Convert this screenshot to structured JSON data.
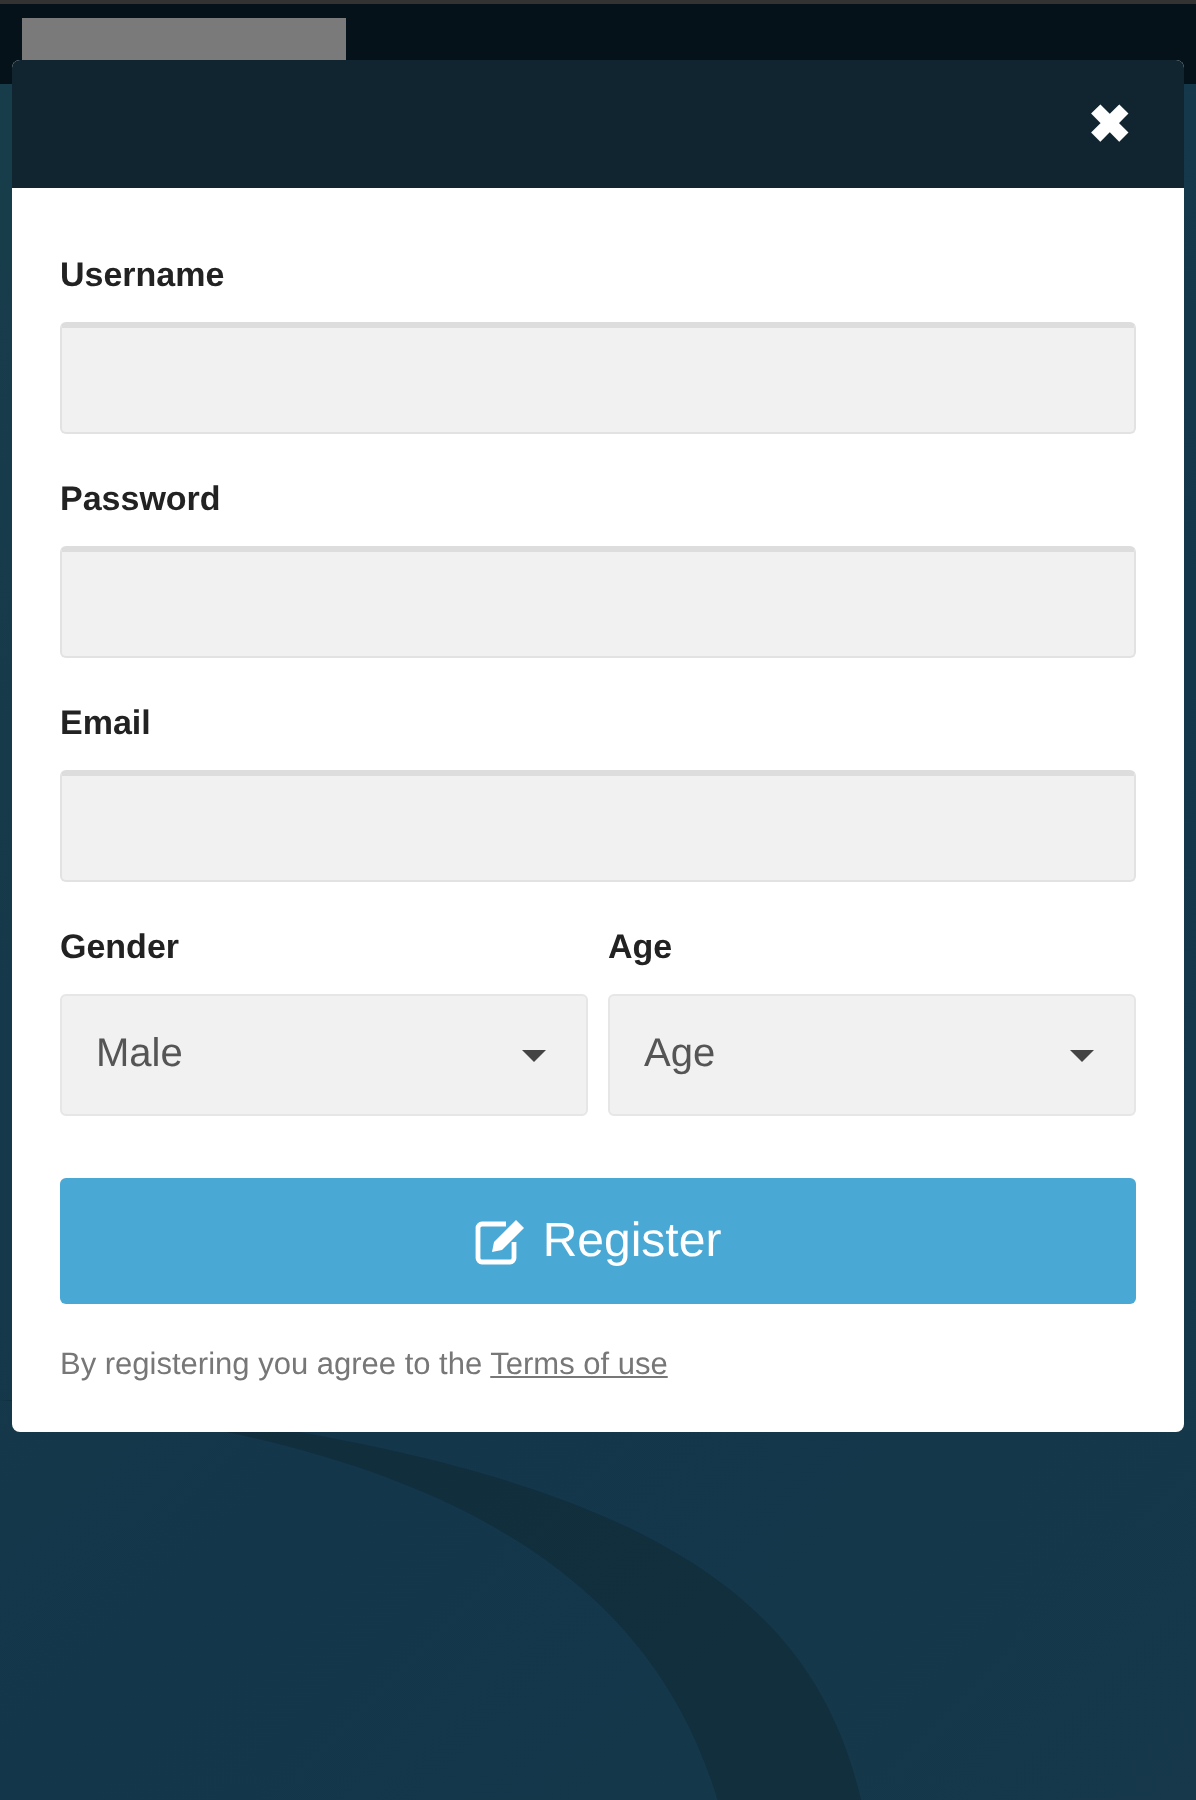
{
  "dialog": {
    "close": "✖",
    "fields": [
      {
        "label": "Username"
      },
      {
        "label": "Password"
      },
      {
        "label": "Email"
      }
    ],
    "selects": [
      {
        "label": "Gender",
        "value": "Male"
      },
      {
        "label": "Age",
        "value": "Age"
      }
    ],
    "button": "Register",
    "terms": {
      "text": "By registering you agree to the",
      "link": "Terms of use"
    }
  }
}
